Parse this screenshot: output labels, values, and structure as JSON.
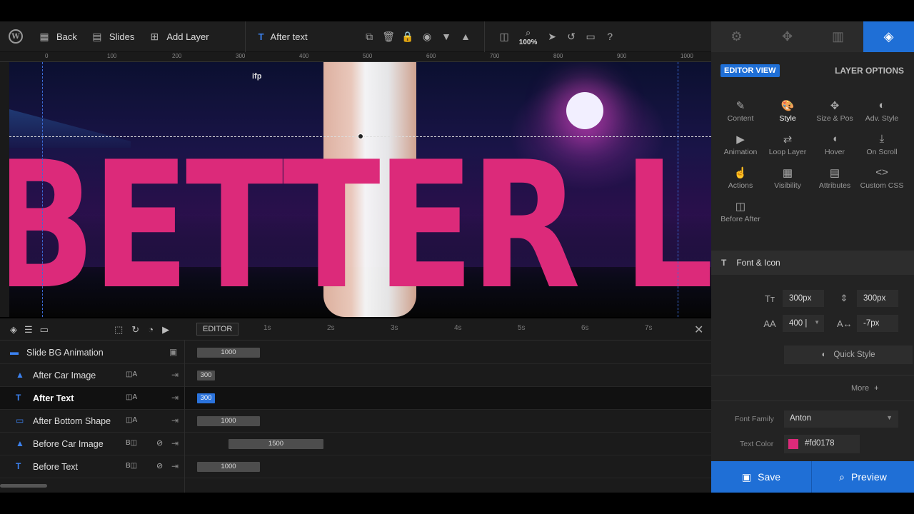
{
  "toolbar": {
    "back_label": "Back",
    "slides_label": "Slides",
    "add_layer_label": "Add Layer",
    "layer_name": "After text",
    "zoom": "100%"
  },
  "ruler": {
    "ticks": [
      "0",
      "100",
      "200",
      "300",
      "400",
      "500",
      "600",
      "700",
      "800",
      "900",
      "1000"
    ]
  },
  "canvas": {
    "headline": "BETTER LIFE",
    "logo_text": "ifp"
  },
  "timeline": {
    "editor_label": "EDITOR",
    "seconds": [
      "1s",
      "2s",
      "3s",
      "4s",
      "5s",
      "6s",
      "7s"
    ],
    "rows": [
      {
        "name": "Slide BG Animation",
        "tag": "",
        "duration": "1000"
      },
      {
        "name": "After Car Image",
        "tag": "A",
        "duration": "300"
      },
      {
        "name": "After Text",
        "tag": "A",
        "duration": "300"
      },
      {
        "name": "After Bottom Shape",
        "tag": "A",
        "duration": "1000"
      },
      {
        "name": "Before Car Image",
        "tag": "B",
        "duration": "1500"
      },
      {
        "name": "Before Text",
        "tag": "B",
        "duration": "1000"
      }
    ]
  },
  "panel": {
    "editor_view": "EDITOR VIEW",
    "layer_options": "LAYER OPTIONS",
    "options": [
      {
        "label": "Content",
        "icon": "pencil-icon"
      },
      {
        "label": "Style",
        "icon": "palette-icon"
      },
      {
        "label": "Size & Pos",
        "icon": "move-icon"
      },
      {
        "label": "Adv. Style",
        "icon": "contrast-icon"
      },
      {
        "label": "Animation",
        "icon": "play-icon"
      },
      {
        "label": "Loop Layer",
        "icon": "loop-icon"
      },
      {
        "label": "Hover",
        "icon": "mouse-icon"
      },
      {
        "label": "On Scroll",
        "icon": "download-icon"
      },
      {
        "label": "Actions",
        "icon": "hand-icon"
      },
      {
        "label": "Visibility",
        "icon": "visibility-icon"
      },
      {
        "label": "Attributes",
        "icon": "file-icon"
      },
      {
        "label": "Custom CSS",
        "icon": "code-icon"
      },
      {
        "label": "Before After",
        "icon": "split-icon"
      }
    ],
    "section_title": "Font & Icon",
    "font_size": "300px",
    "line_height": "300px",
    "font_weight": "400 |",
    "letter_spacing": "-7px",
    "quick_style": "Quick Style",
    "more": "More",
    "font_family_label": "Font Family",
    "font_family": "Anton",
    "text_color_label": "Text Color",
    "text_color": "#fd0178"
  },
  "footer": {
    "save": "Save",
    "preview": "Preview"
  },
  "colors": {
    "accent": "#1f6fd6",
    "headline": "#dc2a7a"
  }
}
